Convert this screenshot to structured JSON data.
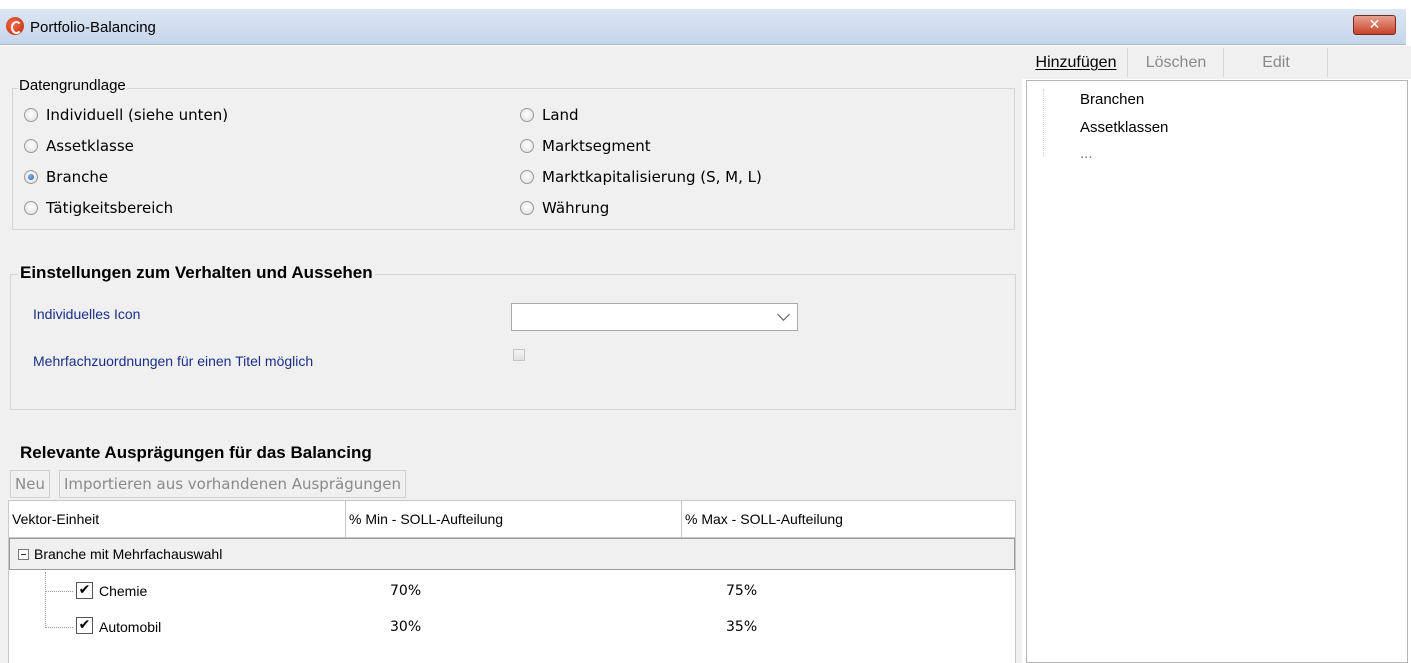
{
  "window": {
    "title": "Portfolio-Balancing",
    "close_symbol": "✕"
  },
  "datengrundlage": {
    "legend": "Datengrundlage",
    "options": [
      {
        "label": "Individuell (siehe unten)",
        "checked": false
      },
      {
        "label": "Assetklasse",
        "checked": false
      },
      {
        "label": "Branche",
        "checked": true
      },
      {
        "label": "Tätigkeitsbereich",
        "checked": false
      },
      {
        "label": "Land",
        "checked": false
      },
      {
        "label": "Marktsegment",
        "checked": false
      },
      {
        "label": "Marktkapitalisierung (S, M, L)",
        "checked": false
      },
      {
        "label": "Währung",
        "checked": false
      }
    ]
  },
  "einstellungen": {
    "legend": "Einstellungen zum Verhalten und Aussehen",
    "icon_label": "Individuelles Icon",
    "icon_value": "",
    "multi_label": "Mehrfachzuordnungen für einen Titel möglich",
    "multi_checked": false
  },
  "balancing": {
    "legend": "Relevante Ausprägungen für das Balancing",
    "toolbar": {
      "new_label": "Neu",
      "import_label": "Importieren aus vorhandenen Ausprägungen"
    },
    "columns": [
      "Vektor-Einheit",
      "% Min - SOLL-Aufteilung",
      "% Max - SOLL-Aufteilung"
    ],
    "group": {
      "expand_symbol": "−",
      "label": "Branche mit Mehrfachauswahl",
      "rows": [
        {
          "name": "Chemie",
          "min": "70%",
          "max": "75%",
          "checked": true,
          "check_symbol": "✔"
        },
        {
          "name": "Automobil",
          "min": "30%",
          "max": "35%",
          "checked": true,
          "check_symbol": "✔"
        }
      ]
    }
  },
  "right_panel": {
    "toolbar": {
      "add_label": "Hinzufügen",
      "delete_label": "Löschen",
      "edit_label": "Edit"
    },
    "items": [
      "Branchen",
      "Assetklassen",
      "..."
    ]
  }
}
